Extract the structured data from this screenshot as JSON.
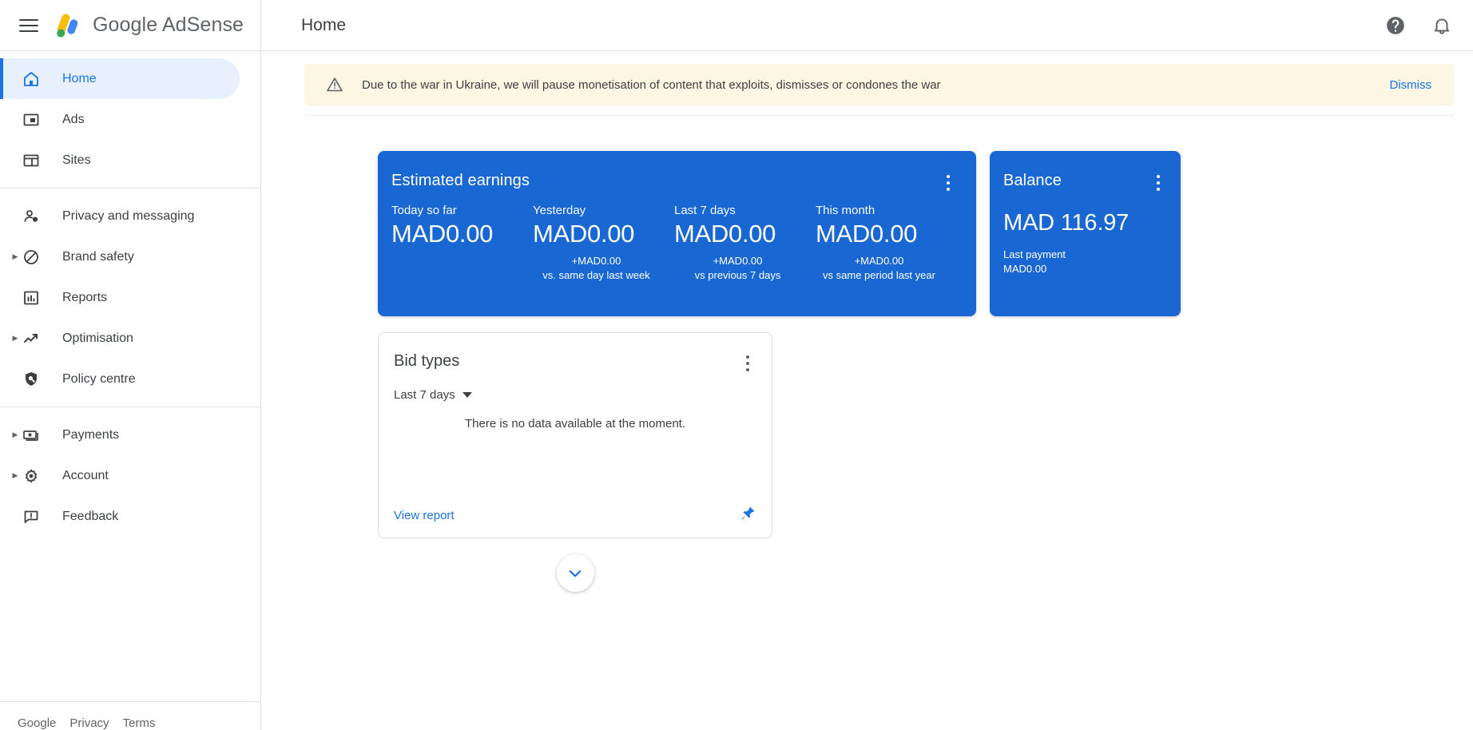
{
  "topbar": {
    "menu_label": "Main menu",
    "brand": "Google AdSense",
    "page_title": "Home",
    "help_label": "?",
    "notifications_label": "Notifications"
  },
  "colors": {
    "accent": "#1a73e8",
    "card_blue": "#1967d2",
    "active_bg": "#e8f0fe",
    "banner_bg": "#fdf6e3",
    "text": "#3c4043"
  },
  "sidebar": {
    "groups": [
      {
        "items": [
          {
            "label": "Home",
            "icon": "home-icon",
            "active": true,
            "expandable": false
          },
          {
            "label": "Ads",
            "icon": "ads-icon",
            "active": false,
            "expandable": false
          },
          {
            "label": "Sites",
            "icon": "sites-icon",
            "active": false,
            "expandable": false
          }
        ]
      },
      {
        "items": [
          {
            "label": "Privacy and messaging",
            "icon": "privacy-person-icon",
            "active": false,
            "expandable": false
          },
          {
            "label": "Brand safety",
            "icon": "block-circle-icon",
            "active": false,
            "expandable": true
          },
          {
            "label": "Reports",
            "icon": "bar-chart-icon",
            "active": false,
            "expandable": false
          },
          {
            "label": "Optimisation",
            "icon": "trending-up-icon",
            "active": false,
            "expandable": true
          },
          {
            "label": "Policy centre",
            "icon": "shield-search-icon",
            "active": false,
            "expandable": false
          }
        ]
      },
      {
        "items": [
          {
            "label": "Payments",
            "icon": "money-icon",
            "active": false,
            "expandable": true
          },
          {
            "label": "Account",
            "icon": "gear-icon",
            "active": false,
            "expandable": true
          },
          {
            "label": "Feedback",
            "icon": "feedback-icon",
            "active": false,
            "expandable": false
          }
        ]
      }
    ],
    "footer": {
      "brand": "Google",
      "links": [
        "Privacy",
        "Terms"
      ]
    }
  },
  "banner": {
    "icon": "warning-triangle-icon",
    "message": "Due to the war in Ukraine, we will pause monetisation of content that exploits, dismisses or condones the war",
    "dismiss_label": "Dismiss"
  },
  "earnings_card": {
    "title": "Estimated earnings",
    "menu_label": "More options",
    "metrics": [
      {
        "label": "Today so far",
        "value": "MAD0.00",
        "delta": "",
        "comparison": ""
      },
      {
        "label": "Yesterday",
        "value": "MAD0.00",
        "delta": "+MAD0.00",
        "comparison": "vs. same day last week"
      },
      {
        "label": "Last 7 days",
        "value": "MAD0.00",
        "delta": "+MAD0.00",
        "comparison": "vs previous 7 days"
      },
      {
        "label": "This month",
        "value": "MAD0.00",
        "delta": "+MAD0.00",
        "comparison": "vs same period last year"
      }
    ]
  },
  "balance_card": {
    "title": "Balance",
    "menu_label": "More options",
    "value": "MAD 116.97",
    "last_payment_label": "Last payment",
    "last_payment_value": "MAD0.00"
  },
  "bid_types_card": {
    "title": "Bid types",
    "menu_label": "More options",
    "date_range": "Last 7 days",
    "empty_message": "There is no data available at the moment.",
    "view_report_label": "View report",
    "pin_label": "Pin card"
  },
  "expand_button": {
    "label": "Show more",
    "icon": "chevron-down-icon"
  }
}
